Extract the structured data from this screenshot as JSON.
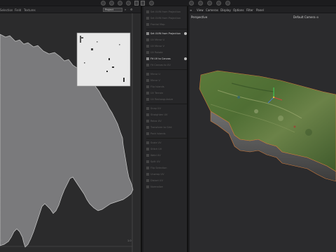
{
  "toolbar": {
    "icons": [
      "render-icon",
      "camera-icon",
      "lock-icon",
      "globe-icon",
      "help-icon",
      "settings-icon",
      "snap-icon",
      "axis-icon"
    ]
  },
  "uv_editor": {
    "menus": [
      "Selection",
      "Field",
      "Textures"
    ],
    "project_select": "Project",
    "axis_tick_left": "0",
    "axis_tick_right": "1.0"
  },
  "commands": {
    "items": [
      {
        "label": "Set UVW from Projection",
        "active": false
      },
      {
        "label": "Set UVW from Projection",
        "active": false
      },
      {
        "label": "Frontal Map",
        "active": false
      },
      {
        "label": "Set UVW from Projection",
        "active": true
      },
      {
        "label": "UV Mirror U",
        "active": false
      },
      {
        "label": "UV Mirror V",
        "active": false
      },
      {
        "label": "UV Rotate",
        "active": false
      },
      {
        "label": "Fit UV to Canvas",
        "active": true
      },
      {
        "label": "Fit Canvas to UV",
        "active": false
      },
      {
        "label": "Mirror U",
        "active": false
      },
      {
        "label": "Mirror V",
        "active": false
      },
      {
        "label": "Flip Islands",
        "active": false
      },
      {
        "label": "UV Terrain",
        "active": false
      },
      {
        "label": "UV Rectangularize",
        "active": false
      },
      {
        "label": "Snap UV",
        "active": false
      },
      {
        "label": "Straighten UV",
        "active": false
      },
      {
        "label": "Relax UV",
        "active": false
      },
      {
        "label": "Transform to Grid",
        "active": false
      },
      {
        "label": "Pack Islands",
        "active": false
      },
      {
        "label": "Scale UV",
        "active": false
      },
      {
        "label": "Stitch UV",
        "active": false
      },
      {
        "label": "Weld UV",
        "active": false
      },
      {
        "label": "Split UV",
        "active": false
      },
      {
        "label": "Flip Selection",
        "active": false
      },
      {
        "label": "Unwrap UV",
        "active": false
      },
      {
        "label": "Distort UV",
        "active": false
      },
      {
        "label": "Normalize",
        "active": false
      }
    ]
  },
  "viewport": {
    "menus": [
      "View",
      "Cameras",
      "Display",
      "Options",
      "Filter",
      "Panel"
    ],
    "projection_label": "Perspective",
    "camera_label": "Default Camera ⊙"
  }
}
